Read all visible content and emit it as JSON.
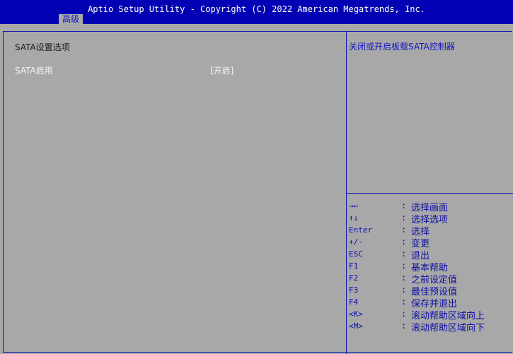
{
  "header": {
    "title": "Aptio Setup Utility - Copyright (C) 2022 American Megatrends, Inc.",
    "active_tab": "高级"
  },
  "main": {
    "section_title": "SATA设置选项",
    "option": {
      "label": "SATA启用",
      "value": "[开启]"
    }
  },
  "help": {
    "description": "关闭或开启板载SATA控制器",
    "keys": [
      {
        "key": "→←",
        "desc": "选择画面"
      },
      {
        "key": "↑↓",
        "desc": "选择选项"
      },
      {
        "key": "Enter",
        "desc": "选择"
      },
      {
        "key": "+/-",
        "desc": "变更"
      },
      {
        "key": "ESC",
        "desc": "退出"
      },
      {
        "key": "F1",
        "desc": "基本帮助"
      },
      {
        "key": "F2",
        "desc": "之前设定值"
      },
      {
        "key": "F3",
        "desc": "最佳预设值"
      },
      {
        "key": "F4",
        "desc": "保存并退出"
      },
      {
        "key": "<K>",
        "desc": "滚动帮助区域向上"
      },
      {
        "key": "<M>",
        "desc": "滚动帮助区域向下"
      }
    ],
    "separator": ":"
  },
  "colors": {
    "header_bg": "#0202b4",
    "panel_bg": "#a8a8a8",
    "help_text": "#1414c8",
    "option_text": "#f4f4f4"
  }
}
